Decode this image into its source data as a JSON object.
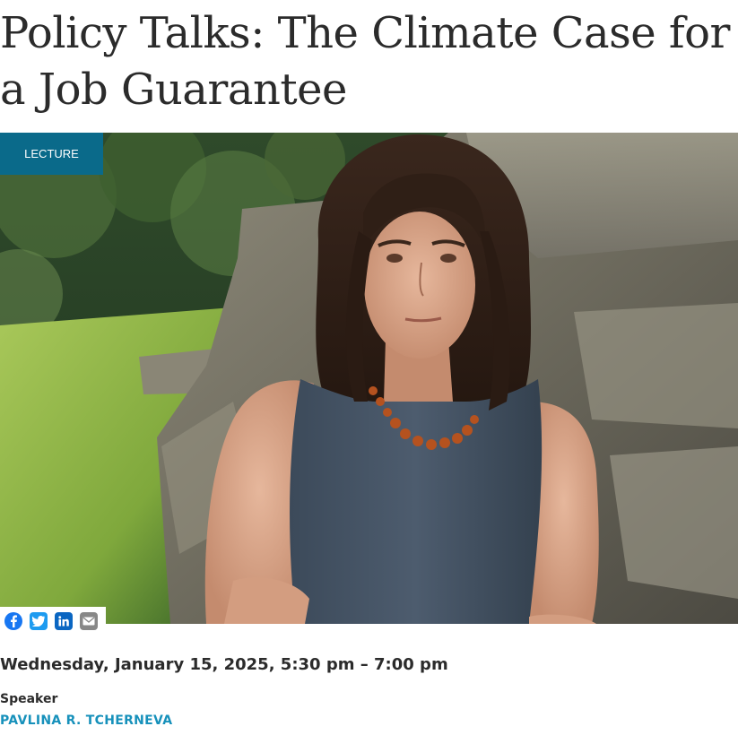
{
  "page": {
    "title": "Policy Talks: The Climate Case for a Job Guarantee"
  },
  "hero": {
    "badge": "LECTURE",
    "image_description_icon": "speaker-portrait-photo"
  },
  "share": {
    "items": [
      {
        "name": "Facebook",
        "icon": "facebook-icon",
        "color": "#1877f2"
      },
      {
        "name": "Twitter",
        "icon": "twitter-icon",
        "color": "#1d9bf0"
      },
      {
        "name": "LinkedIn",
        "icon": "linkedin-icon",
        "color": "#0a66c2"
      },
      {
        "name": "Email",
        "icon": "email-icon",
        "color": "#888888"
      }
    ]
  },
  "event": {
    "datetime": "Wednesday, January 15, 2025, 5:30 pm – 7:00 pm",
    "speaker_label": "Speaker",
    "speaker_name": "PAVLINA R. TCHERNEVA"
  },
  "colors": {
    "badge_bg": "#0a6a8a",
    "link": "#1791bb",
    "text": "#2b2b2b"
  }
}
